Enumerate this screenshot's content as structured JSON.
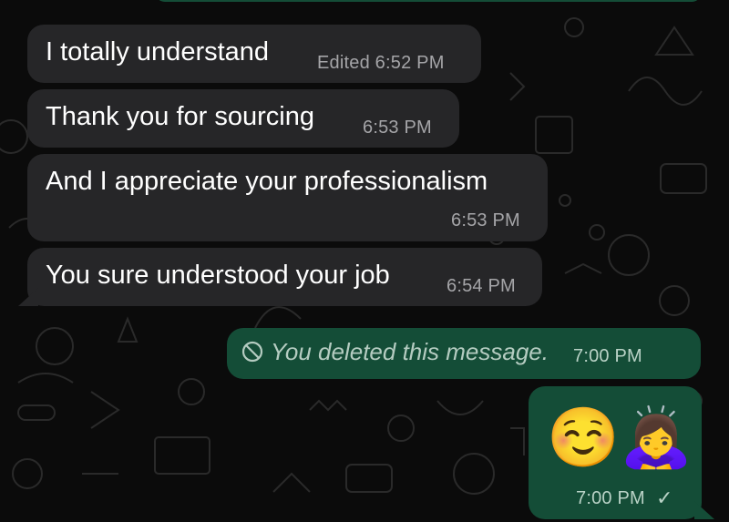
{
  "colors": {
    "background": "#0b0b0b",
    "incoming_bubble": "#262628",
    "outgoing_bubble": "#144d37",
    "timestamp": "#a5a5a8"
  },
  "messages": [
    {
      "direction": "incoming",
      "text": "I totally understand",
      "meta": "Edited 6:52 PM"
    },
    {
      "direction": "incoming",
      "text": "Thank you for sourcing",
      "meta": "6:53 PM"
    },
    {
      "direction": "incoming",
      "text": "And I appreciate your professionalism",
      "meta": "6:53 PM"
    },
    {
      "direction": "incoming",
      "text": "You sure understood your job",
      "meta": "6:54 PM"
    },
    {
      "direction": "outgoing",
      "deleted": true,
      "icon": "prohibited-icon",
      "text": "You deleted this message.",
      "meta": "7:00 PM"
    },
    {
      "direction": "outgoing",
      "emojis": [
        "☺️",
        "🙇‍♀️"
      ],
      "meta": "7:00 PM",
      "status": "✓"
    }
  ]
}
